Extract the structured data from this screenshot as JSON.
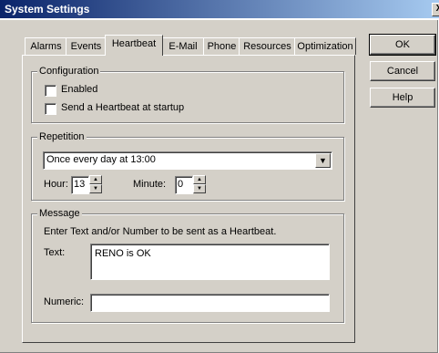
{
  "window": {
    "title": "System Settings",
    "close_glyph": "X"
  },
  "tabs": [
    {
      "label": "Alarms"
    },
    {
      "label": "Events"
    },
    {
      "label": "Heartbeat"
    },
    {
      "label": "E-Mail"
    },
    {
      "label": "Phone"
    },
    {
      "label": "Resources"
    },
    {
      "label": "Optimization"
    }
  ],
  "configuration": {
    "legend": "Configuration",
    "enabled_label": "Enabled",
    "enabled_checked": false,
    "startup_label": "Send a Heartbeat at startup",
    "startup_checked": false
  },
  "repetition": {
    "legend": "Repetition",
    "selected": "Once every day at 13:00",
    "hour_label": "Hour:",
    "hour_value": "13",
    "minute_label": "Minute:",
    "minute_value": "0"
  },
  "message": {
    "legend": "Message",
    "instruction": "Enter Text and/or Number to be sent as a Heartbeat.",
    "text_label": "Text:",
    "text_value": "RENO is OK",
    "numeric_label": "Numeric:",
    "numeric_value": ""
  },
  "buttons": {
    "ok": "OK",
    "cancel": "Cancel",
    "help": "Help"
  },
  "icons": {
    "dropdown": "chevron-down-icon",
    "spin": "spin-arrows-icon"
  }
}
